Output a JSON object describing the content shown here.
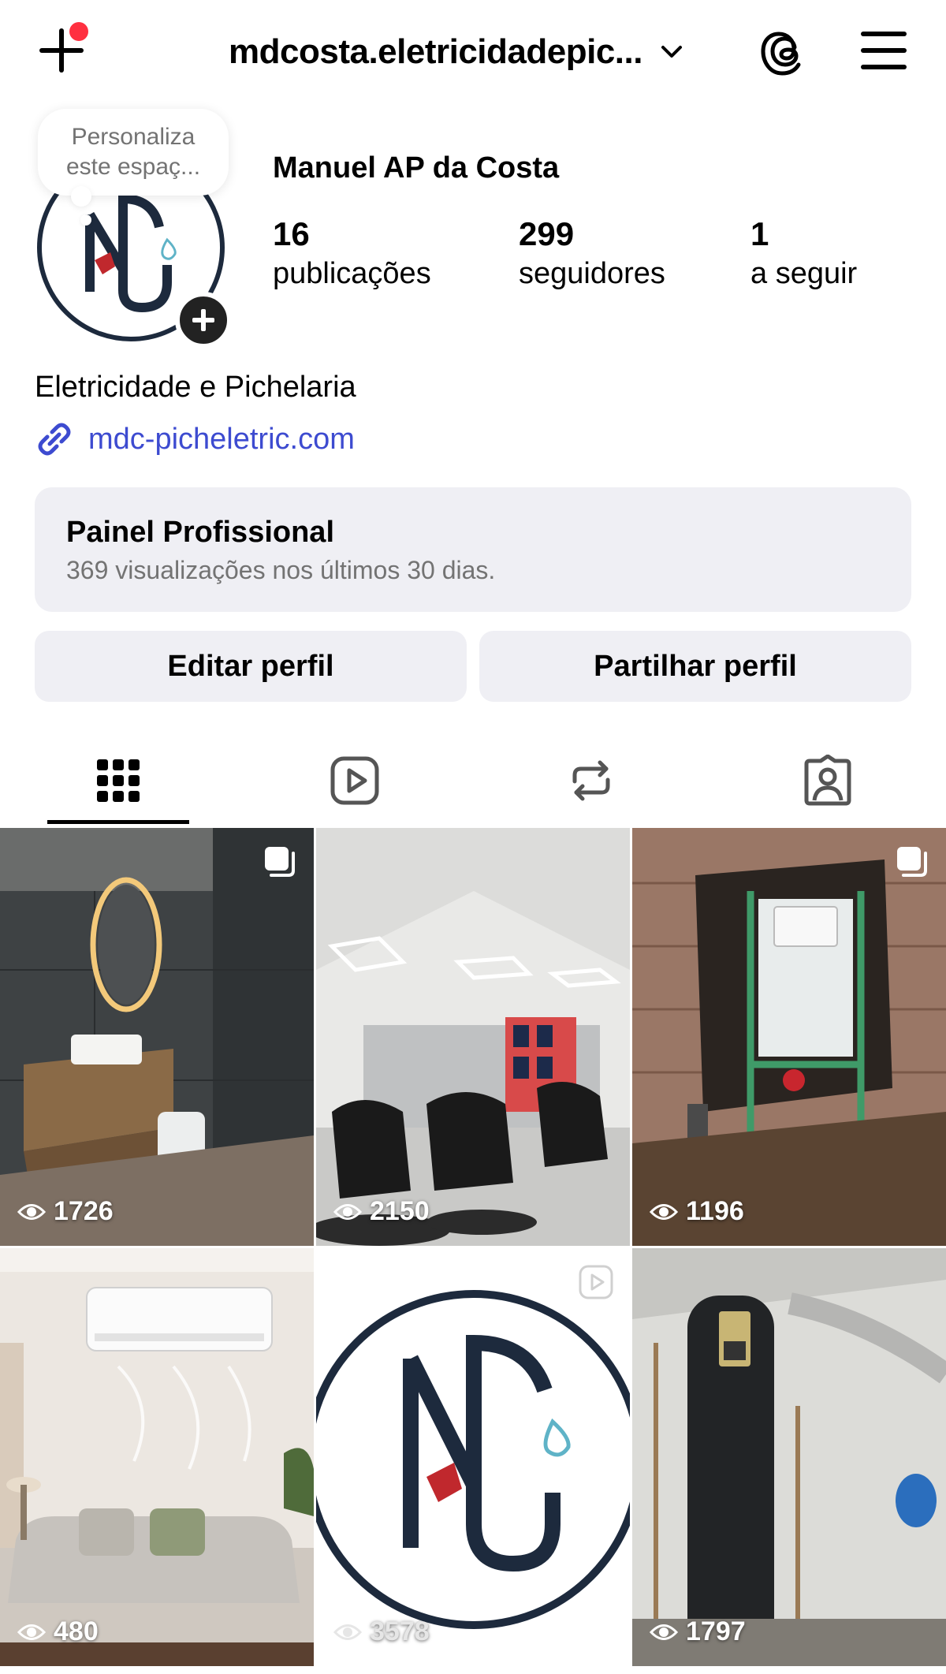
{
  "header": {
    "username": "mdcosta.eletricidadepic...",
    "colors": {
      "notification_dot": "#ff3040"
    }
  },
  "profile": {
    "note": "Personaliza\neste espaç...",
    "full_name": "Manuel AP da Costa",
    "stats": [
      {
        "value": "16",
        "label": "publicações"
      },
      {
        "value": "299",
        "label": "seguidores"
      },
      {
        "value": "1",
        "label": "a seguir"
      }
    ],
    "category": "Eletricidade e Pichelaria",
    "link": "mdc-picheletric.com",
    "link_color": "#3d4bd0"
  },
  "pro_panel": {
    "title": "Painel Profissional",
    "subtitle": "369 visualizações nos últimos 30 dias."
  },
  "buttons": {
    "edit": "Editar perfil",
    "share": "Partilhar perfil"
  },
  "tabs": [
    {
      "icon": "grid-icon",
      "selected": true
    },
    {
      "icon": "reels-icon",
      "selected": false
    },
    {
      "icon": "reposts-icon",
      "selected": false
    },
    {
      "icon": "tagged-icon",
      "selected": false
    }
  ],
  "posts": [
    {
      "views": "1726",
      "type": "carousel",
      "subject": "bathroom"
    },
    {
      "views": "2150",
      "type": "photo",
      "subject": "barbershop"
    },
    {
      "views": "1196",
      "type": "carousel",
      "subject": "plumbing"
    },
    {
      "views": "480",
      "type": "photo",
      "subject": "air-conditioner"
    },
    {
      "views": "3578",
      "type": "reel",
      "subject": "logo"
    },
    {
      "views": "1797",
      "type": "photo",
      "subject": "water-heater"
    }
  ]
}
